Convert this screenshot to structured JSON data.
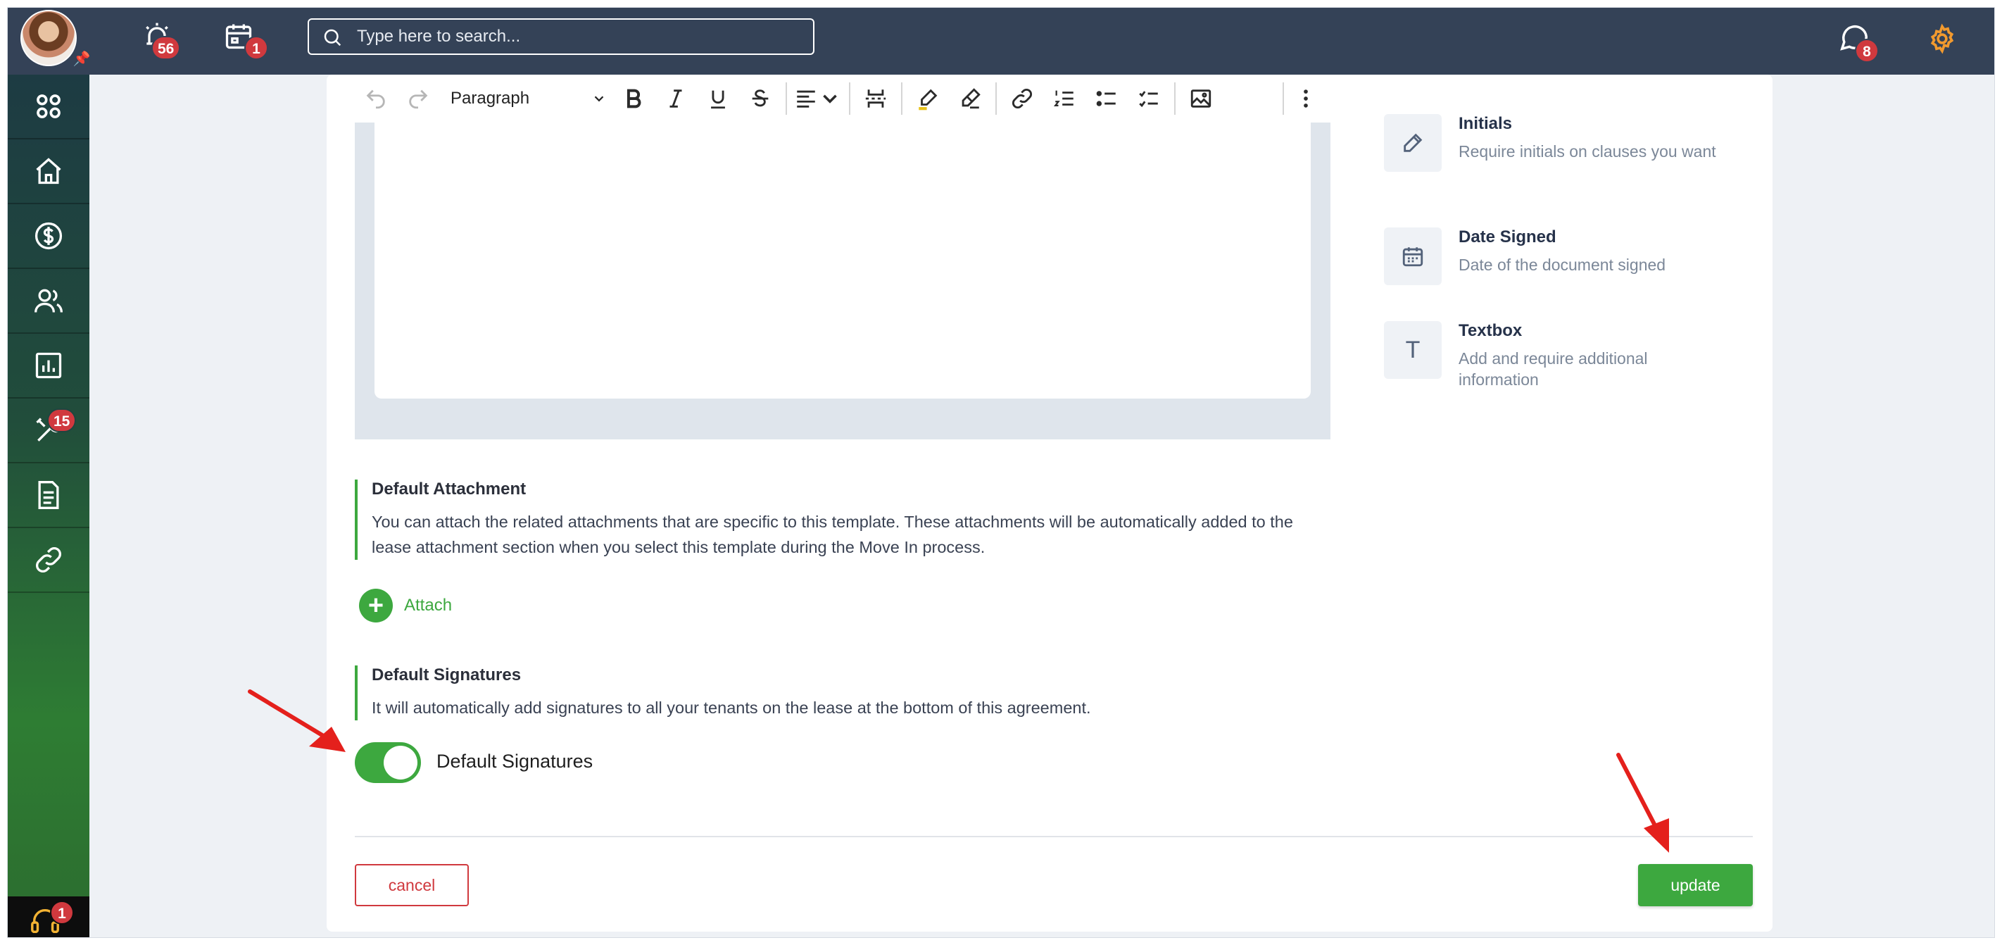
{
  "topbar": {
    "notifications_badge": "56",
    "calendar_badge": "1",
    "search_placeholder": "Type here to search...",
    "messages_badge": "8"
  },
  "sidebar": {
    "maintenance_badge": "15",
    "support_badge": "1"
  },
  "editor": {
    "paragraph_style": "Paragraph"
  },
  "fields": [
    {
      "title": "Initials",
      "description": "Require initials on clauses you want",
      "icon": "pencil-icon"
    },
    {
      "title": "Date Signed",
      "description": "Date of the document signed",
      "icon": "calendar-icon"
    },
    {
      "title": "Textbox",
      "description": "Add and require additional information",
      "icon": "T"
    }
  ],
  "attachment": {
    "title": "Default Attachment",
    "description": "You can attach the related attachments that are specific to this template. These attachments will be automatically added to the lease attachment section when you select this template during the Move In process.",
    "attach_label": "Attach"
  },
  "signatures": {
    "title": "Default Signatures",
    "description": "It will automatically add signatures to all your tenants on the lease at the bottom of this agreement.",
    "toggle_label": "Default Signatures",
    "toggle_on": true
  },
  "actions": {
    "cancel_label": "cancel",
    "update_label": "update"
  },
  "colors": {
    "accent_green": "#3da83f",
    "danger_red": "#d0393e",
    "topbar": "#344257",
    "gear_orange": "#f29a2e"
  }
}
